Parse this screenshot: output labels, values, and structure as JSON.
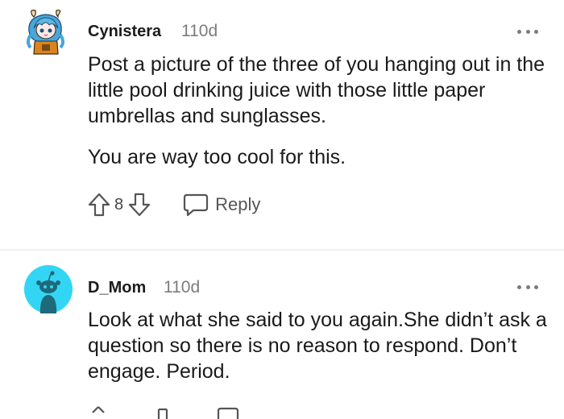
{
  "comments": [
    {
      "username": "Cynistera",
      "age": "110d",
      "paragraphs": [
        "Post a picture of the three of you hanging out in the little pool drinking juice with those little paper umbrellas and sunglasses.",
        "You are way too cool for this."
      ],
      "score": "8",
      "reply_label": "Reply",
      "avatar_icon": "anime-character-avatar-icon"
    },
    {
      "username": "D_Mom",
      "age": "110d",
      "paragraphs": [
        "Look at what she said to you again.She didn’t ask a question so there is no reason to respond. Don’t engage. Period."
      ],
      "avatar_icon": "default-snoo-avatar-icon"
    }
  ],
  "colors": {
    "divider": "#edeff1",
    "avatar_bg": "#33d5f5",
    "meta_gray": "#7c7c7c"
  }
}
